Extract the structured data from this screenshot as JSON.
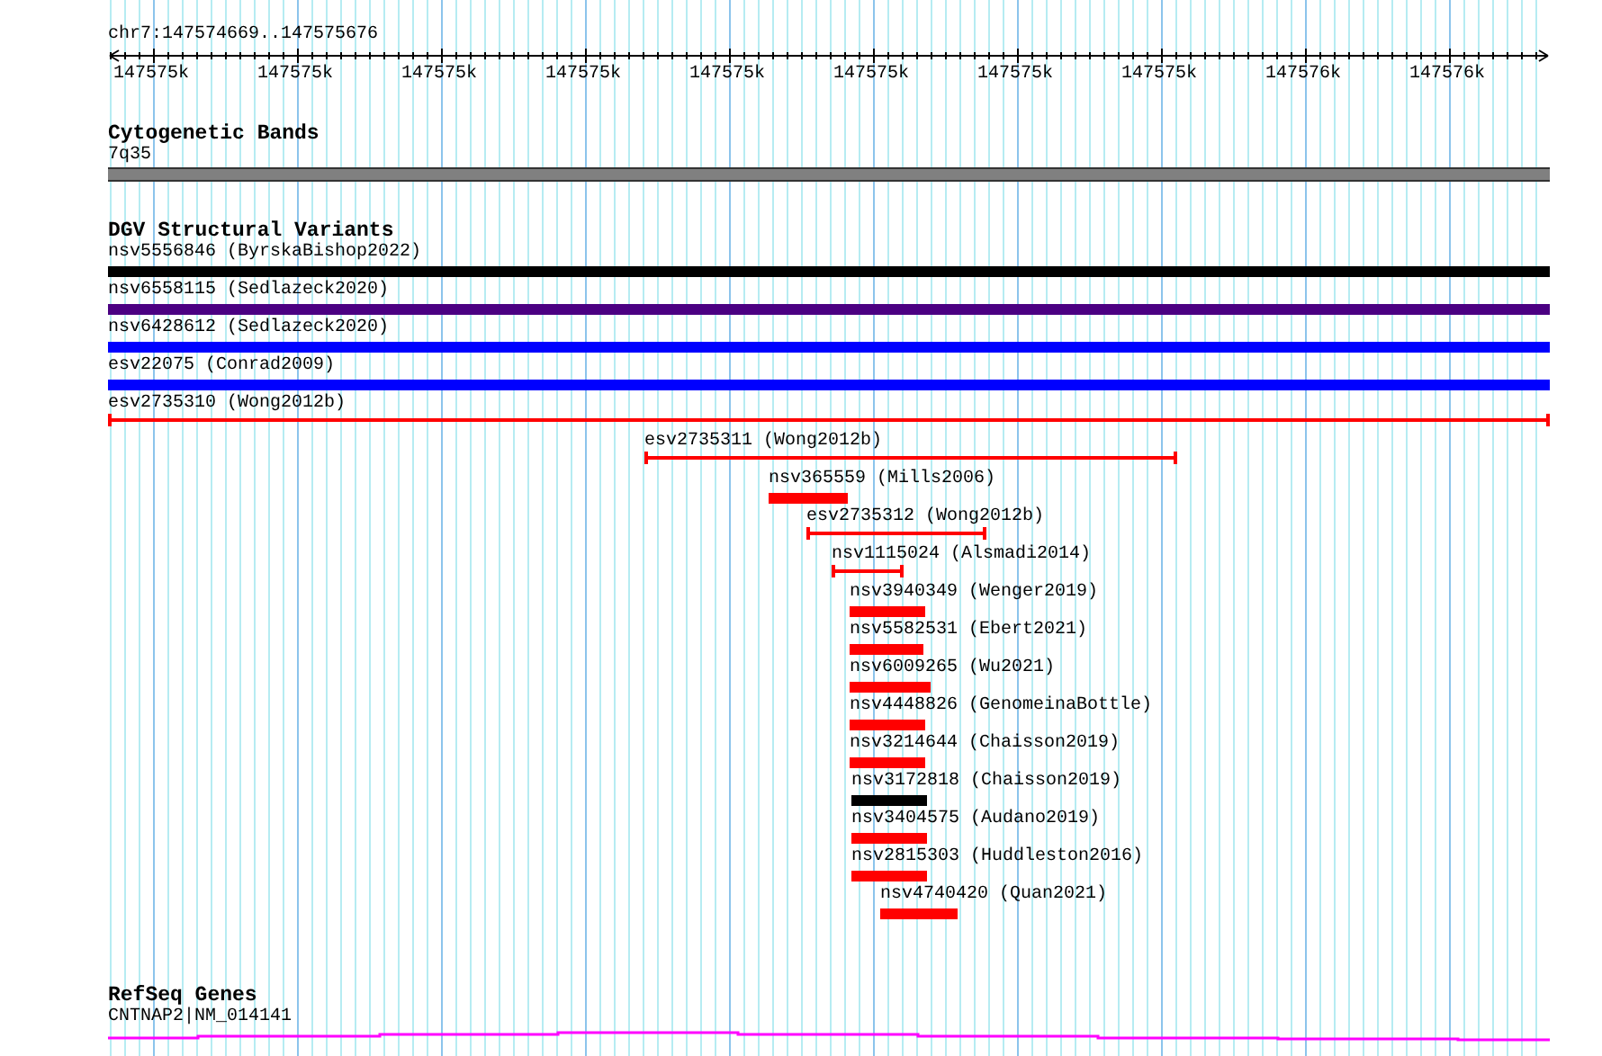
{
  "ruler": {
    "locus": "chr7:147574669..147575676",
    "ticks": [
      "147575k",
      "147575k",
      "147575k",
      "147575k",
      "147575k",
      "147575k",
      "147575k",
      "147575k",
      "147576k",
      "147576k"
    ]
  },
  "cytogenetic_bands": {
    "title": "Cytogenetic Bands",
    "band": "7q35"
  },
  "dgv_structural_variants": {
    "title": "DGV Structural Variants",
    "variants": [
      {
        "label": "nsv5556846 (ByrskaBishop2022)",
        "kind": "bar",
        "color": "#000000"
      },
      {
        "label": "nsv6558115 (Sedlazeck2020)",
        "kind": "bar",
        "color": "#4b0082"
      },
      {
        "label": "nsv6428612 (Sedlazeck2020)",
        "kind": "bar",
        "color": "#0000ff"
      },
      {
        "label": "esv22075 (Conrad2009)",
        "kind": "bar",
        "color": "#0000ff"
      },
      {
        "label": "esv2735310 (Wong2012b)",
        "kind": "span",
        "color": "#ff0000"
      },
      {
        "label": "esv2735311 (Wong2012b)",
        "kind": "span",
        "color": "#ff0000"
      },
      {
        "label": "nsv365559 (Mills2006)",
        "kind": "bar",
        "color": "#ff0000"
      },
      {
        "label": "esv2735312 (Wong2012b)",
        "kind": "span",
        "color": "#ff0000"
      },
      {
        "label": "nsv1115024 (Alsmadi2014)",
        "kind": "span",
        "color": "#ff0000"
      },
      {
        "label": "nsv3940349 (Wenger2019)",
        "kind": "bar",
        "color": "#ff0000"
      },
      {
        "label": "nsv5582531 (Ebert2021)",
        "kind": "bar",
        "color": "#ff0000"
      },
      {
        "label": "nsv6009265 (Wu2021)",
        "kind": "bar",
        "color": "#ff0000"
      },
      {
        "label": "nsv4448826 (GenomeinaBottle)",
        "kind": "bar",
        "color": "#ff0000"
      },
      {
        "label": "nsv3214644 (Chaisson2019)",
        "kind": "bar",
        "color": "#ff0000"
      },
      {
        "label": "nsv3172818 (Chaisson2019)",
        "kind": "bar",
        "color": "#000000"
      },
      {
        "label": "nsv3404575 (Audano2019)",
        "kind": "bar",
        "color": "#ff0000"
      },
      {
        "label": "nsv2815303 (Huddleston2016)",
        "kind": "bar",
        "color": "#ff0000"
      },
      {
        "label": "nsv4740420 (Quan2021)",
        "kind": "bar",
        "color": "#ff0000"
      }
    ]
  },
  "refseq_genes": {
    "title": "RefSeq Genes",
    "gene": "CNTNAP2|NM_014141"
  }
}
